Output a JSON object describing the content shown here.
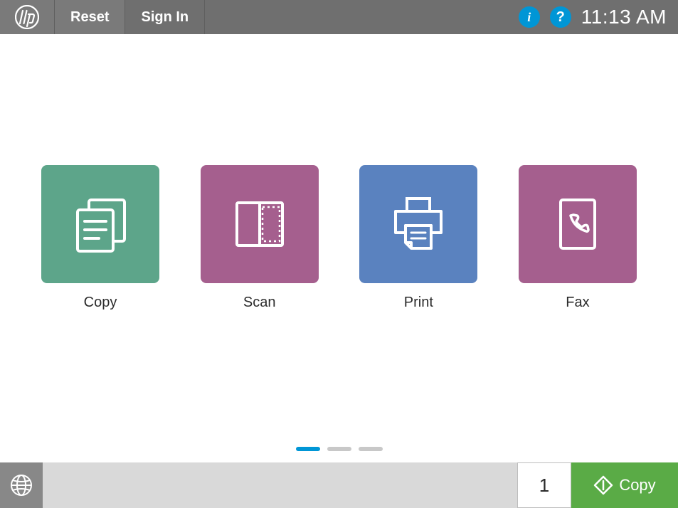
{
  "header": {
    "reset_label": "Reset",
    "signin_label": "Sign In",
    "time": "11:13 AM"
  },
  "tiles": [
    {
      "id": "copy",
      "label": "Copy",
      "color": "green"
    },
    {
      "id": "scan",
      "label": "Scan",
      "color": "mauve"
    },
    {
      "id": "print",
      "label": "Print",
      "color": "blue"
    },
    {
      "id": "fax",
      "label": "Fax",
      "color": "mauve"
    }
  ],
  "pagination": {
    "pages": 3,
    "active": 0
  },
  "footer": {
    "quantity": "1",
    "action_label": "Copy"
  }
}
